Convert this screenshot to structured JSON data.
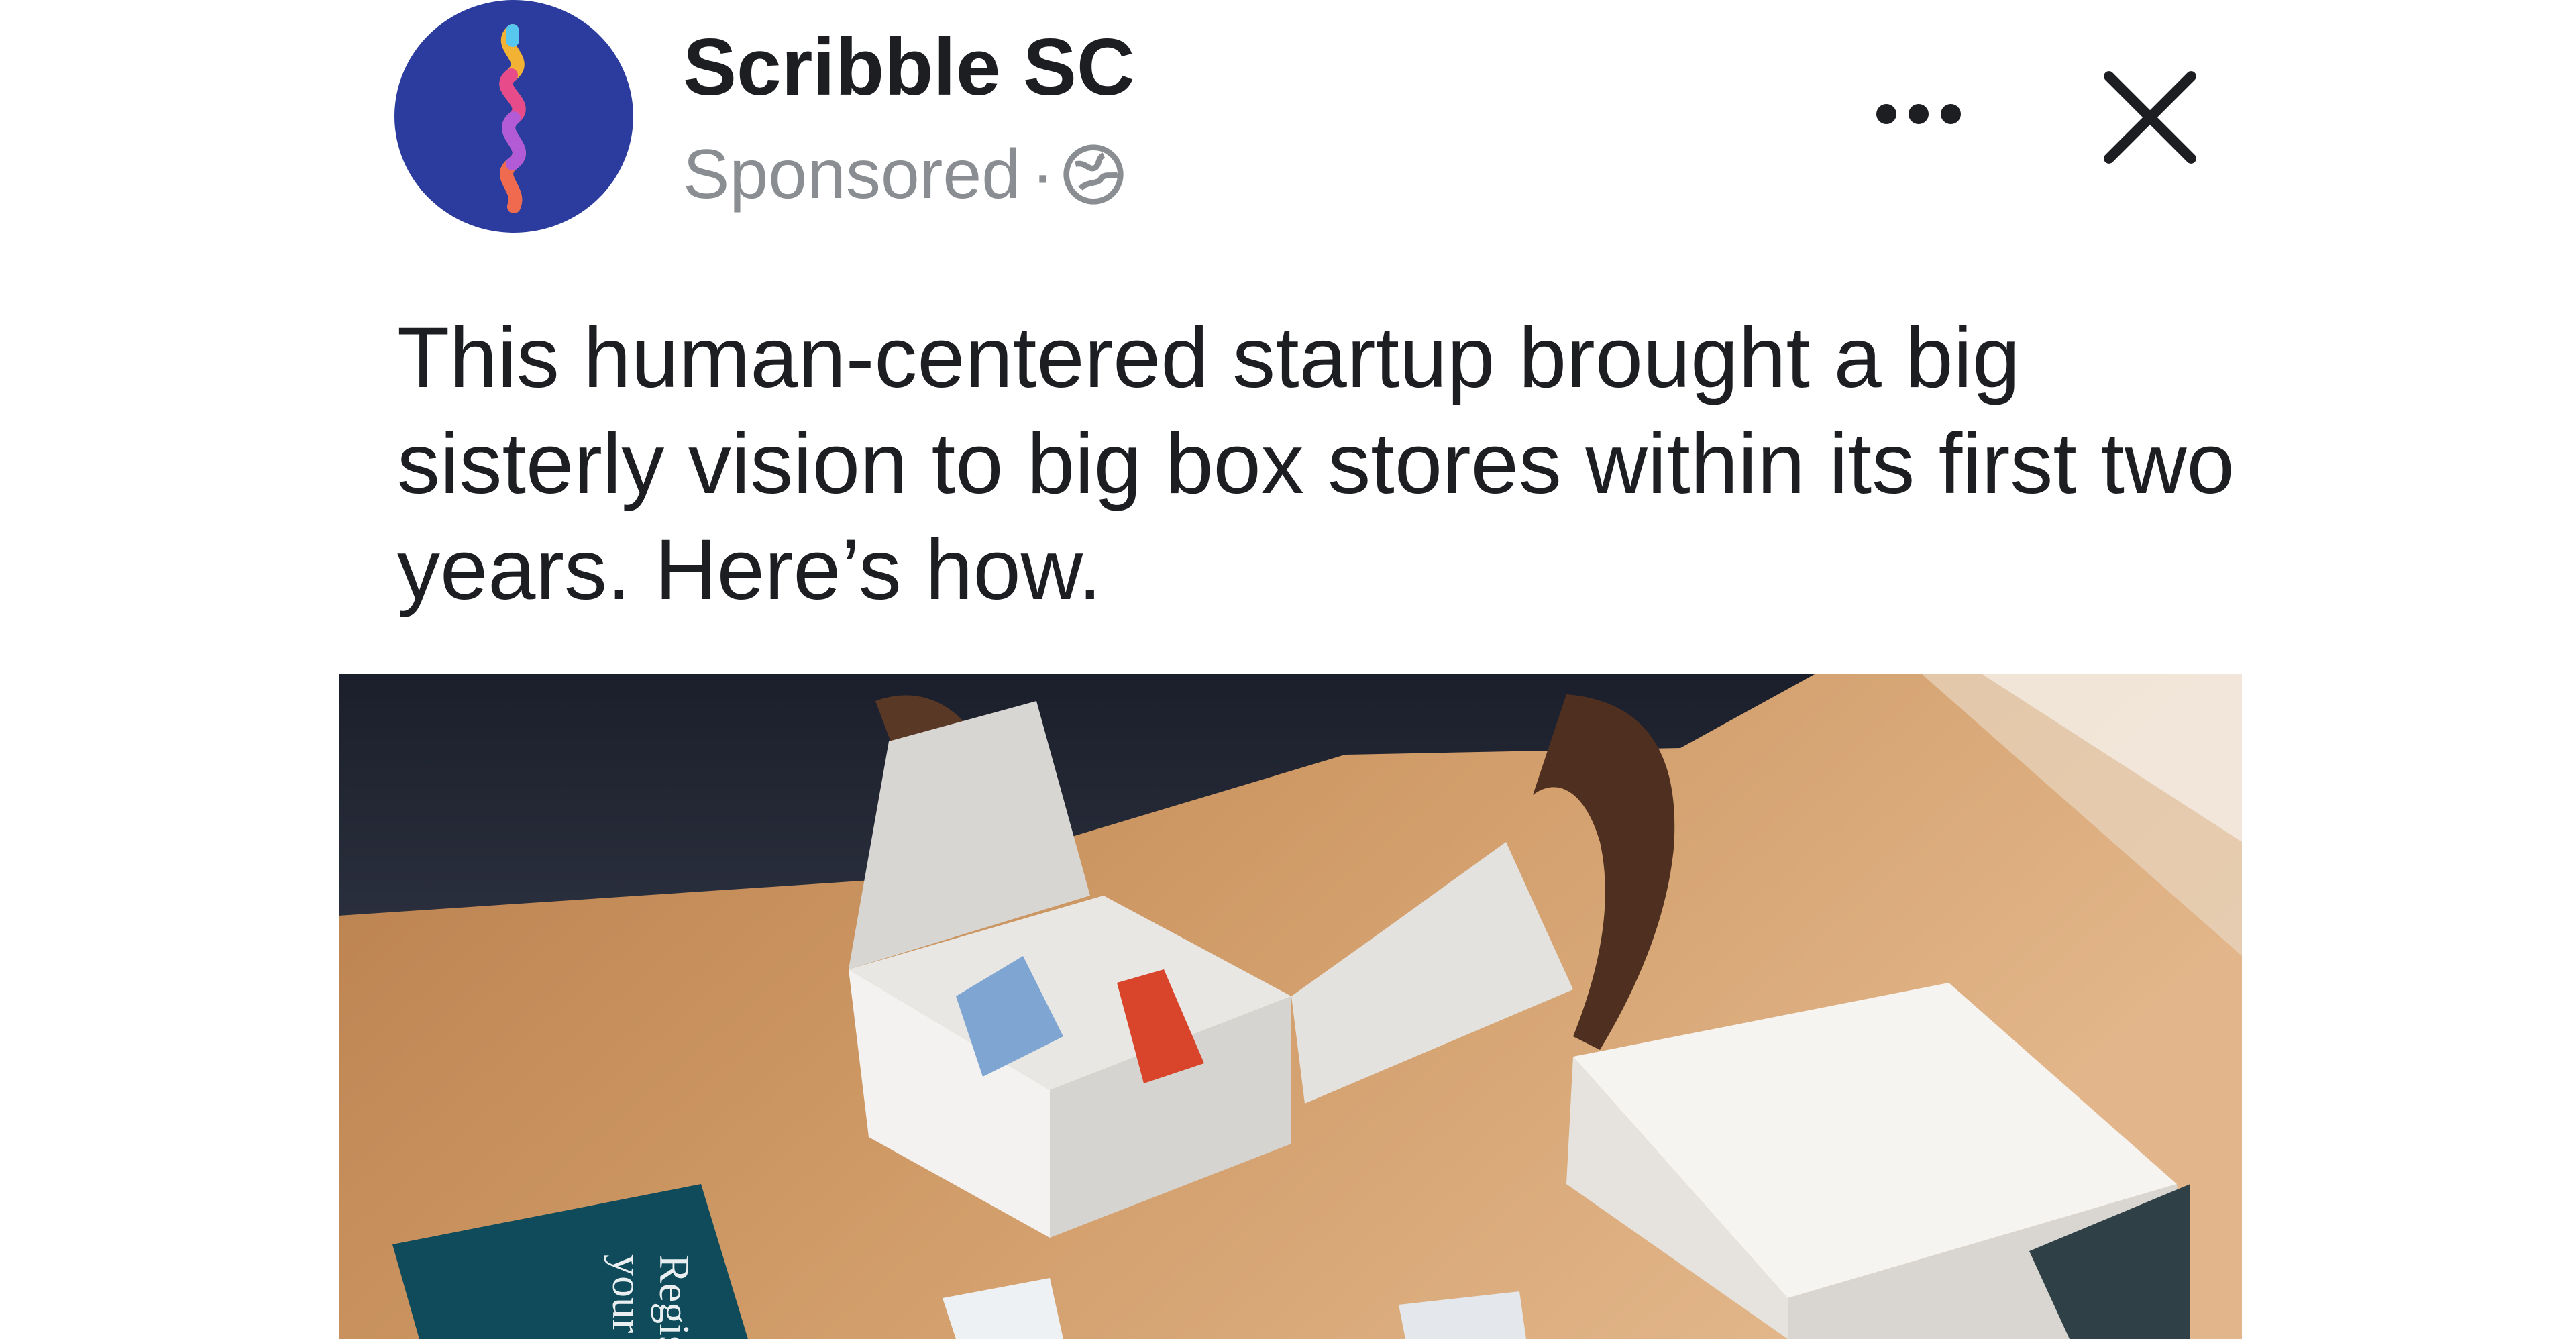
{
  "post": {
    "page_name": "Scribble SC",
    "sponsored_label": "Sponsored",
    "separator": "·",
    "privacy_icon": "globe-icon",
    "more_icon": "more-options-icon",
    "close_icon": "close-icon",
    "caption": "This human-centered startup brought a big sisterly vision to big box stores within its first two years. Here’s how."
  },
  "ad_image": {
    "booklet_lines": [
      "Regis",
      "your"
    ]
  },
  "colors": {
    "avatar_bg": "#2b3c9e",
    "text_primary": "#1c1e21",
    "text_secondary": "#8a8d91",
    "table_wood": "#c8925e",
    "booklet": "#0f4b5a"
  }
}
